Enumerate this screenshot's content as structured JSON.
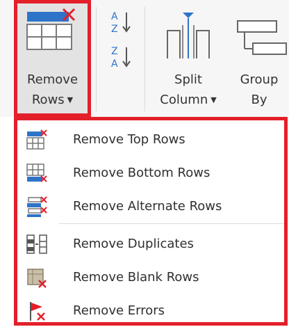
{
  "ribbon": {
    "remove_rows": {
      "line1": "Remove",
      "line2": "Rows"
    },
    "split_column": {
      "line1": "Split",
      "line2": "Column"
    },
    "group_by": {
      "line1": "Group",
      "line2": "By"
    },
    "sort_ascending_icon": "sort-ascending-icon",
    "sort_descending_icon": "sort-descending-icon",
    "highlight_color": "#e31f2a",
    "accent_color": "#2e74c8"
  },
  "menu": {
    "items": [
      {
        "label": "Remove Top Rows",
        "icon": "remove-top-rows-icon"
      },
      {
        "label": "Remove Bottom Rows",
        "icon": "remove-bottom-rows-icon"
      },
      {
        "label": "Remove Alternate Rows",
        "icon": "remove-alternate-rows-icon"
      },
      {
        "label": "Remove Duplicates",
        "icon": "remove-duplicates-icon"
      },
      {
        "label": "Remove Blank Rows",
        "icon": "remove-blank-rows-icon"
      },
      {
        "label": "Remove Errors",
        "icon": "remove-errors-icon"
      }
    ]
  }
}
